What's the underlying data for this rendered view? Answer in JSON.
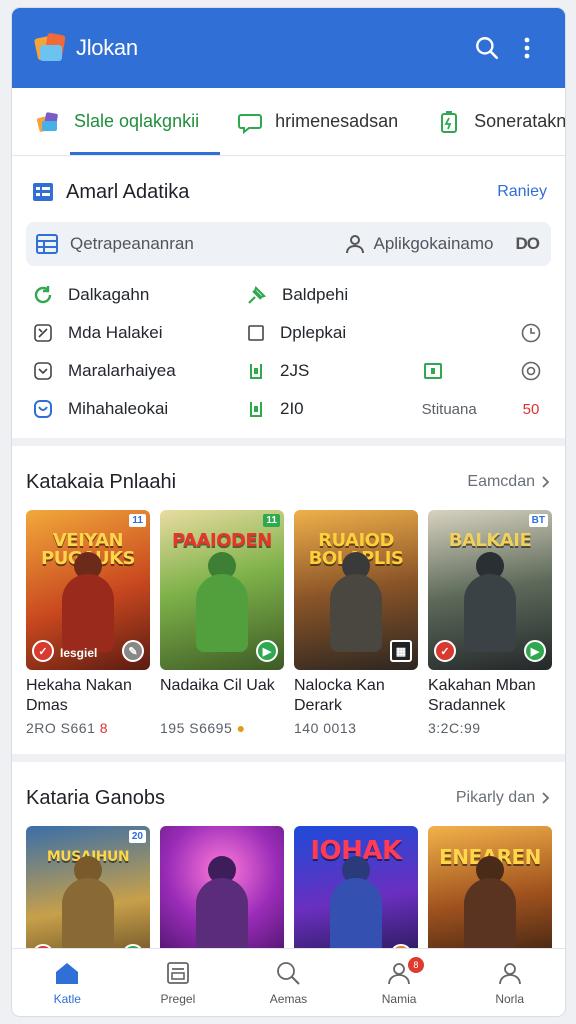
{
  "app": {
    "title": "Jlokan"
  },
  "tabs": [
    {
      "label": "Slale oqlakgnkii"
    },
    {
      "label": "hrimenesadsan"
    },
    {
      "label": "Soneratakn"
    }
  ],
  "section1": {
    "title": "Amarl Adatika",
    "action": "Raniey",
    "search_placeholder": "Qetrapeananran",
    "search_right_label": "Aplikgokainamo",
    "search_right_tag": "DO",
    "rows": [
      {
        "left": "Dalkagahn",
        "mid": "Baldpehi"
      },
      {
        "left": "Mda Halakei",
        "mid": "Dplepkai"
      },
      {
        "left": "Maralarhaiyea",
        "mid": "2JS"
      },
      {
        "left": "Mihahaleokai",
        "mid": "2I0",
        "val2": "Stituana",
        "val3": "50"
      }
    ]
  },
  "section2": {
    "title": "Katakaia Pnlaahi",
    "action": "Eamcdan",
    "games": [
      {
        "cover_text": "VEIYAN PUGAUKS",
        "tag": "11",
        "badge_text": "Iesgiel",
        "name": "Hekaha Nakan Dmas",
        "meta": "2RO S661",
        "meta_extra": "8"
      },
      {
        "cover_text": "PAAIODEN",
        "tag": "11",
        "name": "Nadaika Cil Uak",
        "meta": "195 S6695",
        "meta_extra": ""
      },
      {
        "cover_text": "RUAIOD BOLAPLIS",
        "tag": "",
        "name": "Nalocka Kan Derark",
        "meta": "140 0013",
        "meta_extra": ""
      },
      {
        "cover_text": "BALKAIE",
        "tag": "BT",
        "name": "Kakahan Mban Sradannek",
        "meta": "3:2C:99",
        "meta_extra": ""
      }
    ]
  },
  "section3": {
    "title": "Kataria Ganobs",
    "action": "Pikarly dan",
    "games": [
      {
        "cover_text": "MUSAIHUN",
        "tag": "20"
      },
      {
        "cover_text": "",
        "tag": ""
      },
      {
        "cover_text": "IOHAK",
        "tag": ""
      },
      {
        "cover_text": "ENEAREN",
        "tag": ""
      }
    ]
  },
  "bottom_nav": [
    {
      "label": "Katle"
    },
    {
      "label": "Pregel"
    },
    {
      "label": "Aemas"
    },
    {
      "label": "Namia",
      "badge": "8"
    },
    {
      "label": "Norla"
    }
  ],
  "colors": {
    "primary": "#2f6fd6",
    "active_tab_text": "#1f8f3a",
    "price_red": "#dd3333",
    "badge_red": "#e03a2f",
    "badge_green": "#2fa84f"
  }
}
